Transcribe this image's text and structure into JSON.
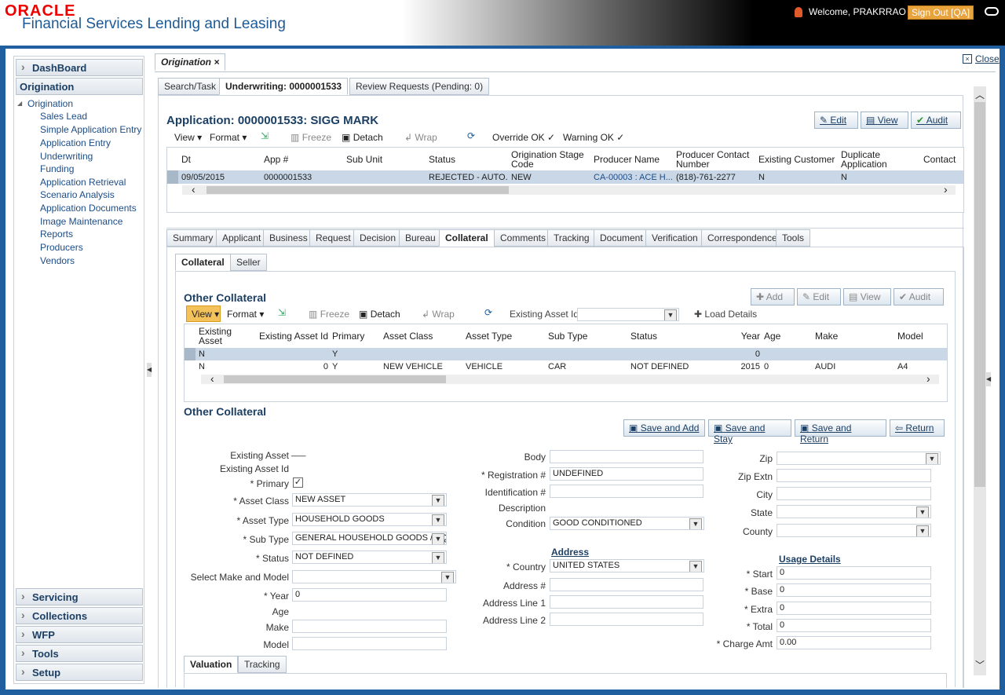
{
  "header": {
    "logo": "ORACLE",
    "product": "Financial Services Lending and Leasing",
    "welcome": "Welcome, PRAKRRAO ▾",
    "signout": "Sign Out [QA]"
  },
  "sidebar": {
    "dashboard": "DashBoard",
    "origination": "Origination",
    "tree_root": "Origination",
    "items": [
      "Sales Lead",
      "Simple Application Entry",
      "Application Entry",
      "Underwriting",
      "Funding",
      "Application Retrieval",
      "Scenario Analysis",
      "Application Documents",
      "Image Maintenance",
      "Reports",
      "Producers",
      "Vendors"
    ],
    "bottom": [
      "Servicing",
      "Collections",
      "WFP",
      "Tools",
      "Setup"
    ]
  },
  "page": {
    "tab": "Origination",
    "close": "Close"
  },
  "subtabs": [
    "Search/Task",
    "Underwriting: 0000001533",
    "Review Requests (Pending: 0)"
  ],
  "app": {
    "title": "Application: 0000001533: SIGG MARK",
    "edit": "Edit",
    "view": "View",
    "audit": "Audit"
  },
  "toolbar": {
    "view": "View ▾",
    "format": "Format ▾",
    "freeze": "Freeze",
    "detach": "Detach",
    "wrap": "Wrap",
    "override": "Override OK ✓",
    "warning": "Warning OK ✓"
  },
  "appgrid": {
    "headers": [
      "Dt",
      "App #",
      "Sub Unit",
      "Status",
      "Origination Stage Code",
      "Producer Name",
      "Producer Contact Number",
      "Existing Customer",
      "Duplicate Application",
      "Contact"
    ],
    "row": [
      "09/05/2015",
      "0000001533",
      "",
      "REJECTED - AUTO...",
      "NEW",
      "CA-00003 : ACE H...",
      "(818)-761-2277",
      "N",
      "N",
      ""
    ]
  },
  "mtabs": [
    "Summary",
    "Applicant",
    "Business",
    "Request",
    "Decision",
    "Bureau",
    "Collateral",
    "Comments",
    "Tracking",
    "Document",
    "Verification",
    "Correspondence",
    "Tools"
  ],
  "ctabs": [
    "Collateral",
    "Seller"
  ],
  "other": {
    "title": "Other Collateral",
    "add": "Add",
    "edit": "Edit",
    "view": "View",
    "audit": "Audit",
    "view_btn": "View ▾",
    "format": "Format ▾",
    "freeze": "Freeze",
    "detach": "Detach",
    "wrap": "Wrap",
    "asset_label": "Existing Asset Id",
    "load": "Load Details"
  },
  "cgrid": {
    "headers": [
      "Existing Asset",
      "Existing Asset Id",
      "Primary",
      "Asset Class",
      "Asset Type",
      "Sub Type",
      "Status",
      "Year",
      "Age",
      "Make",
      "Model"
    ],
    "rows": [
      [
        "N",
        "",
        "Y",
        "",
        "",
        "",
        "",
        "0",
        "",
        "",
        ""
      ],
      [
        "N",
        "0",
        "Y",
        "NEW VEHICLE",
        "VEHICLE",
        "CAR",
        "NOT DEFINED",
        "2015",
        "0",
        "AUDI",
        "A4"
      ]
    ]
  },
  "form": {
    "title": "Other Collateral",
    "save_add": "Save and Add",
    "save_stay": "Save and Stay",
    "save_return": "Save and Return",
    "return": "Return",
    "l_existing": "Existing Asset",
    "v_existing": "___",
    "l_existing_id": "Existing Asset Id",
    "l_primary": "* Primary",
    "l_class": "* Asset Class",
    "v_class": "NEW ASSET",
    "l_type": "* Asset Type",
    "v_type": "HOUSEHOLD GOODS",
    "l_subtype": "* Sub Type",
    "v_subtype": "GENERAL HOUSEHOLD GOODS / EQ",
    "l_status": "* Status",
    "v_status": "NOT DEFINED",
    "l_make_model": "Select Make and Model",
    "l_year": "* Year",
    "v_year": "0",
    "l_age": "Age",
    "l_make": "Make",
    "l_model": "Model",
    "l_body": "Body",
    "l_reg": "* Registration #",
    "v_reg": "UNDEFINED",
    "l_ident": "Identification #",
    "l_desc": "Description",
    "l_cond": "Condition",
    "v_cond": "GOOD CONDITIONED",
    "address": "Address",
    "l_country": "* Country",
    "v_country": "UNITED STATES",
    "l_addr": "Address #",
    "l_line1": "Address Line 1",
    "l_line2": "Address Line 2",
    "l_zip": "Zip",
    "l_zipx": "Zip Extn",
    "l_city": "City",
    "l_state": "State",
    "l_county": "County",
    "usage": "Usage Details",
    "l_start": "* Start",
    "v_start": "0",
    "l_base": "* Base",
    "v_base": "0",
    "l_extra": "* Extra",
    "v_extra": "0",
    "l_total": "* Total",
    "v_total": "0",
    "l_charge": "* Charge Amt",
    "v_charge": "0.00"
  },
  "btabs": [
    "Valuation",
    "Tracking"
  ]
}
